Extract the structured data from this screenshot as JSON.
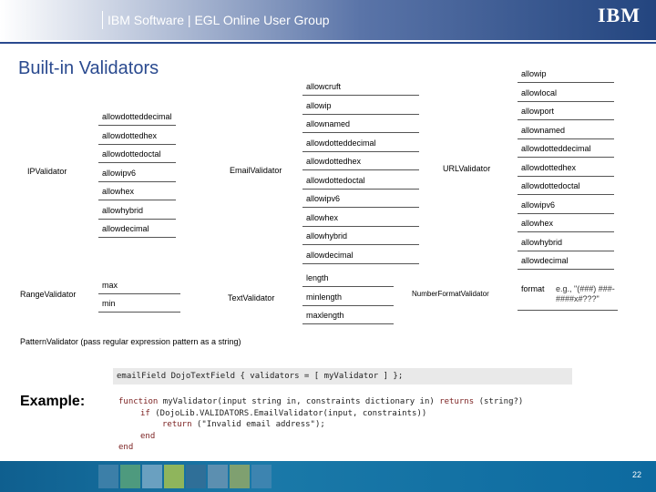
{
  "header": {
    "title": "IBM Software | EGL Online User Group",
    "logo": "IBM"
  },
  "slide": {
    "title": "Built-in Validators"
  },
  "ip_validator": {
    "label": "IPValidator",
    "options": [
      "allowdotteddecimal",
      "allowdottedhex",
      "allowdottedoctal",
      "allowipv6",
      "allowhex",
      "allowhybrid",
      "allowdecimal"
    ]
  },
  "email_validator": {
    "label": "EmailValidator",
    "options": [
      "allowcruft",
      "allowip",
      "allownamed",
      "allowdotteddecimal",
      "allowdottedhex",
      "allowdottedoctal",
      "allowipv6",
      "allowhex",
      "allowhybrid",
      "allowdecimal"
    ]
  },
  "url_validator": {
    "label": "URLValidator",
    "options": [
      "allowip",
      "allowlocal",
      "allowport",
      "allownamed",
      "allowdotteddecimal",
      "allowdottedhex",
      "allowdottedoctal",
      "allowipv6",
      "allowhex",
      "allowhybrid",
      "allowdecimal"
    ]
  },
  "range_validator": {
    "label": "RangeValidator",
    "options": [
      "max",
      "min"
    ]
  },
  "text_validator": {
    "label": "TextValidator",
    "options": [
      "length",
      "minlength",
      "maxlength"
    ]
  },
  "number_format_validator": {
    "label": "NumberFormatValidator",
    "option_key": "format",
    "option_example": "e.g., \"(###) ###-####x#???\""
  },
  "pattern_validator": {
    "label": "PatternValidator (pass regular expression pattern as a string)"
  },
  "example": {
    "label": "Example:",
    "code_box": "emailField DojoTextField { validators = [ myValidator ] };",
    "code_lines": [
      {
        "kw": "function",
        "text": " myValidator(input string in, constraints dictionary in) ",
        "kw2": "returns",
        "text2": " (string?)"
      },
      {
        "kw": "if",
        "text": " (DojoLib.VALIDATORS.EmailValidator(input, constraints))",
        "kw2": "",
        "text2": ""
      },
      {
        "kw": "return",
        "text": " (\"Invalid email address\");",
        "kw2": "",
        "text2": ""
      },
      {
        "kw": "end",
        "text": "",
        "kw2": "",
        "text2": ""
      },
      {
        "kw": "end",
        "text": "",
        "kw2": "",
        "text2": ""
      }
    ]
  },
  "footer": {
    "page_number": "22"
  },
  "colors": {
    "title_blue": "#2a4a8f",
    "footer_blue": "#1a79a8",
    "keyword": "#7a1f1f"
  }
}
